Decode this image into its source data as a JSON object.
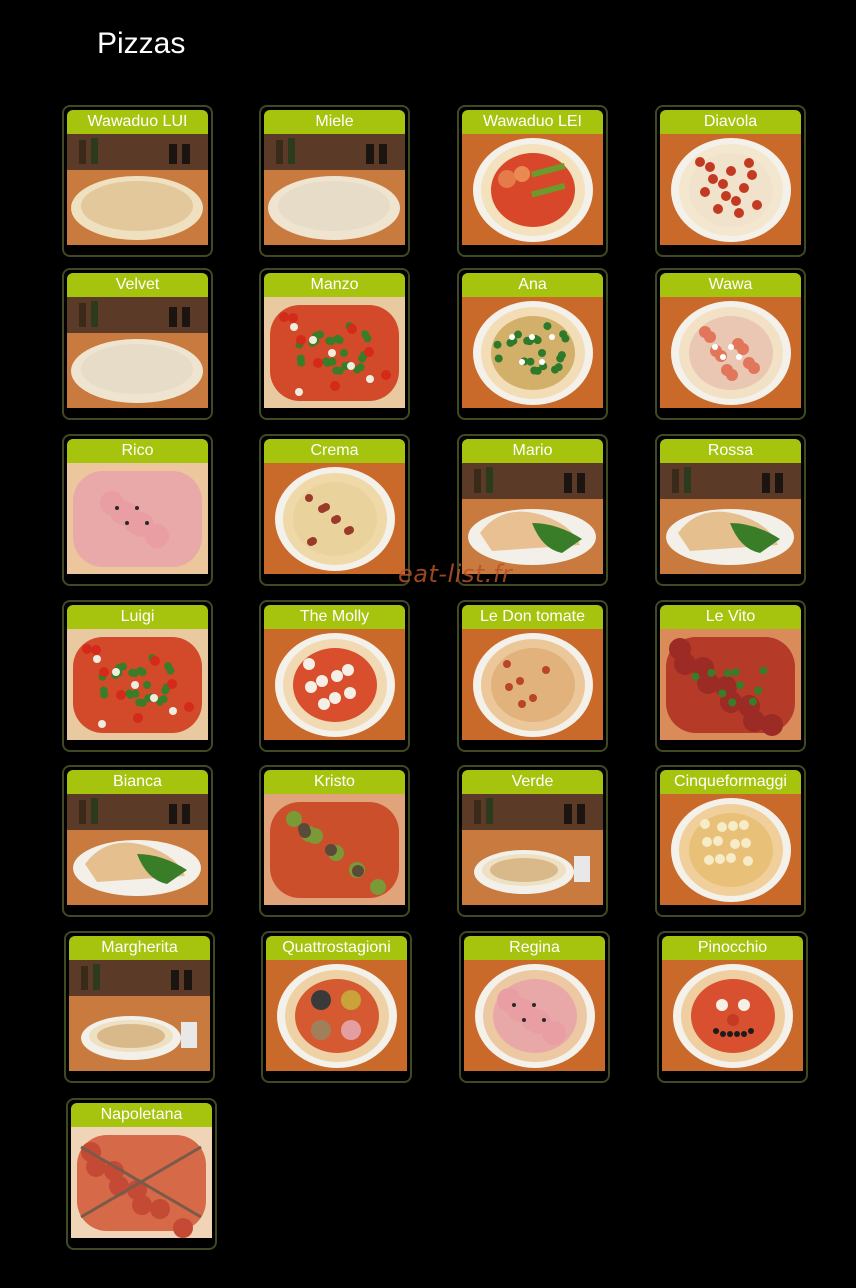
{
  "page": {
    "title": "Pizzas",
    "watermark": "eat-list.fr"
  },
  "colors": {
    "background": "#000000",
    "label_bar": "#a6c40e",
    "card_border": "#3f4a22",
    "table_orange": "#c9692a",
    "watermark": "#b8532a"
  },
  "pizzas": [
    {
      "name": "Wawaduo LUI",
      "photo": "tilted-pizza-photo",
      "style": "angled-cream"
    },
    {
      "name": "Miele",
      "photo": "tilted-pizza-photo",
      "style": "angled-white"
    },
    {
      "name": "Wawaduo LEI",
      "photo": "top-pizza-photo",
      "style": "shrimp"
    },
    {
      "name": "Diavola",
      "photo": "top-pizza-photo",
      "style": "tomato-red"
    },
    {
      "name": "Velvet",
      "photo": "tilted-pizza-photo",
      "style": "angled-white"
    },
    {
      "name": "Manzo",
      "photo": "top-pizza-photo",
      "style": "arugula-closeup"
    },
    {
      "name": "Ana",
      "photo": "top-pizza-photo",
      "style": "spinach"
    },
    {
      "name": "Wawa",
      "photo": "top-pizza-photo",
      "style": "salmon"
    },
    {
      "name": "Rico",
      "photo": "top-pizza-photo",
      "style": "ham-closeup"
    },
    {
      "name": "Crema",
      "photo": "top-pizza-photo",
      "style": "cream"
    },
    {
      "name": "Mario",
      "photo": "tilted-pizza-photo",
      "style": "calzone"
    },
    {
      "name": "Rossa",
      "photo": "tilted-pizza-photo",
      "style": "calzone-salad"
    },
    {
      "name": "Luigi",
      "photo": "top-pizza-photo",
      "style": "arugula-closeup"
    },
    {
      "name": "The Molly",
      "photo": "top-pizza-photo",
      "style": "mozzarella"
    },
    {
      "name": "Le Don tomate",
      "photo": "top-pizza-photo",
      "style": "calzone-plate"
    },
    {
      "name": "Le Vito",
      "photo": "top-pizza-photo",
      "style": "salami-closeup"
    },
    {
      "name": "Bianca",
      "photo": "tilted-pizza-photo",
      "style": "calzone-salad"
    },
    {
      "name": "Kristo",
      "photo": "top-pizza-photo",
      "style": "zucchini-closeup"
    },
    {
      "name": "Verde",
      "photo": "tilted-pizza-photo",
      "style": "table-wide"
    },
    {
      "name": "Cinqueformaggi",
      "photo": "top-pizza-photo",
      "style": "four-cheese"
    },
    {
      "name": "Margherita",
      "photo": "tilted-pizza-photo",
      "style": "table-wide"
    },
    {
      "name": "Quattrostagioni",
      "photo": "top-pizza-photo",
      "style": "four-seasons"
    },
    {
      "name": "Regina",
      "photo": "top-pizza-photo",
      "style": "ham"
    },
    {
      "name": "Pinocchio",
      "photo": "top-pizza-photo",
      "style": "face"
    },
    {
      "name": "Napoletana",
      "photo": "top-pizza-photo",
      "style": "anchovy-closeup"
    }
  ]
}
